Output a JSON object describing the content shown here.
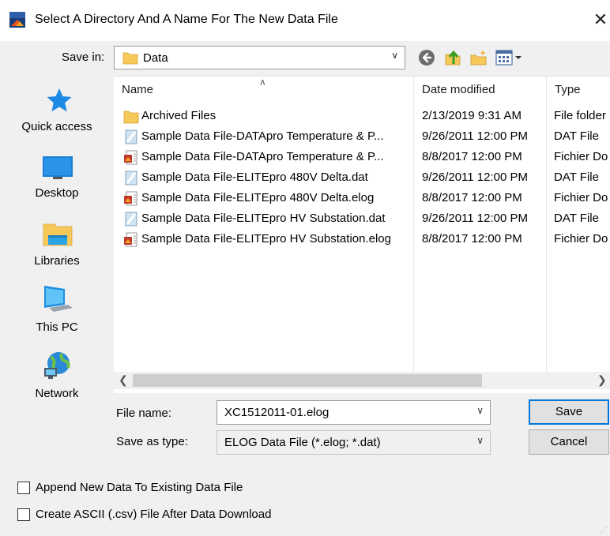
{
  "window": {
    "title": "Select A Directory And A Name For The New Data File",
    "close_glyph": "✕",
    "app_icon": "elog-app-icon"
  },
  "toolbar": {
    "save_in_label": "Save in:",
    "save_in_value": "Data",
    "back_icon": "back-arrow-icon",
    "up_icon": "up-folder-icon",
    "new_folder_icon": "new-folder-icon",
    "view_icon": "view-menu-icon"
  },
  "places": [
    {
      "label": "Quick access",
      "icon": "star-icon"
    },
    {
      "label": "Desktop",
      "icon": "desktop-icon"
    },
    {
      "label": "Libraries",
      "icon": "libraries-icon"
    },
    {
      "label": "This PC",
      "icon": "computer-icon"
    },
    {
      "label": "Network",
      "icon": "network-icon"
    }
  ],
  "columns": {
    "name": "Name",
    "date": "Date modified",
    "type": "Type"
  },
  "files": [
    {
      "name": "Archived Files",
      "date": "2/13/2019 9:31 AM",
      "type": "File folder",
      "icon": "folder-icon"
    },
    {
      "name": "Sample Data File-DATApro Temperature & P...",
      "date": "9/26/2011 12:00 PM",
      "type": "DAT File",
      "icon": "dat-file-icon"
    },
    {
      "name": "Sample Data File-DATApro Temperature & P...",
      "date": "8/8/2017 12:00 PM",
      "type": "Fichier Do",
      "icon": "elog-file-icon"
    },
    {
      "name": "Sample Data File-ELITEpro 480V Delta.dat",
      "date": "9/26/2011 12:00 PM",
      "type": "DAT File",
      "icon": "dat-file-icon"
    },
    {
      "name": "Sample Data File-ELITEpro 480V Delta.elog",
      "date": "8/8/2017 12:00 PM",
      "type": "Fichier Do",
      "icon": "elog-file-icon"
    },
    {
      "name": "Sample Data File-ELITEpro HV Substation.dat",
      "date": "9/26/2011 12:00 PM",
      "type": "DAT File",
      "icon": "dat-file-icon"
    },
    {
      "name": "Sample Data File-ELITEpro HV Substation.elog",
      "date": "8/8/2017 12:00 PM",
      "type": "Fichier Do",
      "icon": "elog-file-icon"
    }
  ],
  "form": {
    "file_name_label": "File name:",
    "file_name_value": "XC1512011-01.elog",
    "save_type_label": "Save as type:",
    "save_type_value": "ELOG Data File (*.elog; *.dat)",
    "save_button": "Save",
    "cancel_button": "Cancel"
  },
  "options": {
    "append_label": "Append New Data To Existing Data File",
    "append_checked": false,
    "csv_label": "Create ASCII (.csv) File After Data Download",
    "csv_checked": false
  },
  "colors": {
    "accent": "#0078d7",
    "folder": "#f6c859",
    "dialog_bg": "#f0f0f0"
  }
}
